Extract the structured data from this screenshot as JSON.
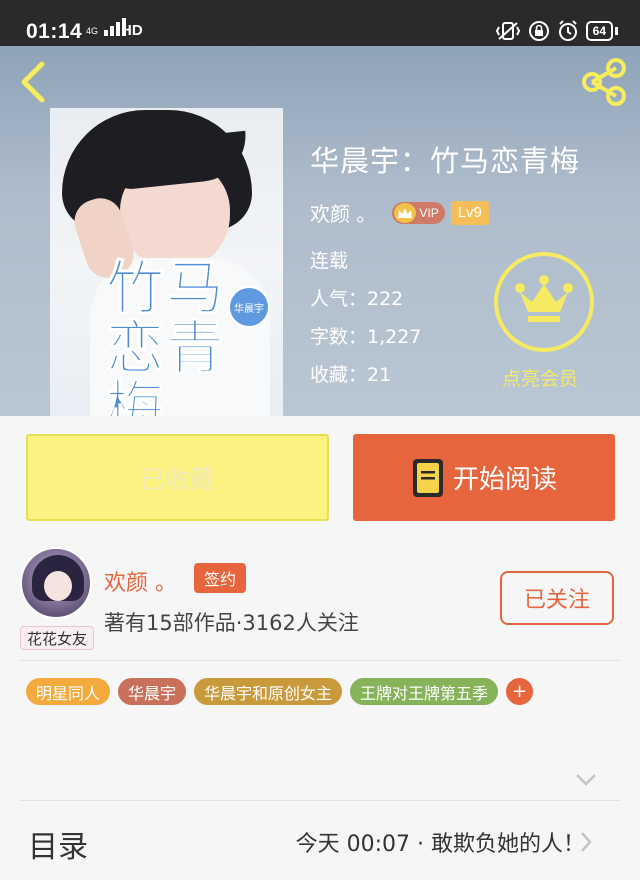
{
  "status_bar": {
    "time": "01:14",
    "network": "4G",
    "hd": "HD",
    "battery": "64"
  },
  "header": {
    "book_title": "华晨宇：竹马恋青梅",
    "author": "欢颜 。",
    "vip_label": "VIP",
    "level": "Lv9",
    "status": "连载",
    "popularity": "人气：222",
    "word_count": "字数：1,227",
    "favorites": "收藏：21",
    "member_label": "点亮会员",
    "cover": {
      "title": "竹马恋青梅",
      "badge": "华晨宇"
    }
  },
  "actions": {
    "collected_label": "已收藏",
    "read_label": "开始阅读"
  },
  "author_profile": {
    "name": "欢颜 。",
    "sign_badge": "签约",
    "stats": "著有15部作品·3162人关注",
    "follow_label": "已关注",
    "avatar_frame_label": "花花女友"
  },
  "tags": [
    {
      "label": "明星同人",
      "color": "#f3a93c"
    },
    {
      "label": "华晨宇",
      "color": "#c9705a"
    },
    {
      "label": "华晨宇和原创女主",
      "color": "#c99a3c"
    },
    {
      "label": "王牌对王牌第五季",
      "color": "#86b25a"
    }
  ],
  "tag_add_label": "+",
  "toc": {
    "label": "目录",
    "latest": "今天 00:07 · 敢欺负她的人！"
  },
  "colors": {
    "accent": "#e7653d",
    "collected_bg": "#fbf381",
    "member": "#f5ea62"
  }
}
